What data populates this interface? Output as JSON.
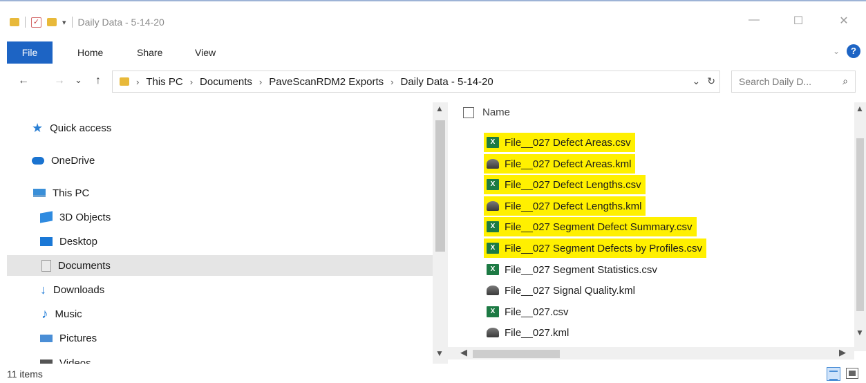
{
  "window": {
    "title": "Daily Data - 5-14-20",
    "minimize": "—",
    "maximize": "☐",
    "close": "✕"
  },
  "ribbon": {
    "tabs": [
      "File",
      "Home",
      "Share",
      "View"
    ]
  },
  "address": {
    "back": "←",
    "forward": "→",
    "recent": "⌄",
    "up": "↑",
    "crumbs": [
      "This PC",
      "Documents",
      "PaveScanRDM2 Exports",
      "Daily Data - 5-14-20"
    ],
    "separator": "›",
    "dropdown": "⌄",
    "refresh": "↻"
  },
  "search": {
    "placeholder": "Search Daily D...",
    "icon": "⌕"
  },
  "nav": {
    "items": [
      {
        "label": "Quick access",
        "icon": "star-icon"
      },
      {
        "label": "OneDrive",
        "icon": "cloud-icon"
      },
      {
        "label": "This PC",
        "icon": "computer-icon"
      },
      {
        "label": "3D Objects",
        "icon": "cube-icon"
      },
      {
        "label": "Desktop",
        "icon": "desktop-icon"
      },
      {
        "label": "Documents",
        "icon": "document-icon",
        "selected": true
      },
      {
        "label": "Downloads",
        "icon": "download-icon"
      },
      {
        "label": "Music",
        "icon": "music-icon"
      },
      {
        "label": "Pictures",
        "icon": "pictures-icon"
      },
      {
        "label": "Videos",
        "icon": "videos-icon"
      }
    ]
  },
  "filelist": {
    "column_name": "Name",
    "files": [
      {
        "name": "File__027 Defect Areas.csv",
        "type": "csv",
        "highlighted": true
      },
      {
        "name": "File__027 Defect Areas.kml",
        "type": "kml",
        "highlighted": true
      },
      {
        "name": "File__027 Defect Lengths.csv",
        "type": "csv",
        "highlighted": true
      },
      {
        "name": "File__027 Defect Lengths.kml",
        "type": "kml",
        "highlighted": true
      },
      {
        "name": "File__027 Segment Defect Summary.csv",
        "type": "csv",
        "highlighted": true
      },
      {
        "name": "File__027 Segment Defects by Profiles.csv",
        "type": "csv",
        "highlighted": true
      },
      {
        "name": "File__027 Segment Statistics.csv",
        "type": "csv",
        "highlighted": false
      },
      {
        "name": "File__027 Signal Quality.kml",
        "type": "kml",
        "highlighted": false
      },
      {
        "name": "File__027.csv",
        "type": "csv",
        "highlighted": false
      },
      {
        "name": "File__027.kml",
        "type": "kml",
        "highlighted": false
      }
    ],
    "highlight_color": "#fff000"
  },
  "status": {
    "item_count": "11 items"
  },
  "colors": {
    "accent": "#1d64c4",
    "excel_green": "#1d7a44"
  }
}
